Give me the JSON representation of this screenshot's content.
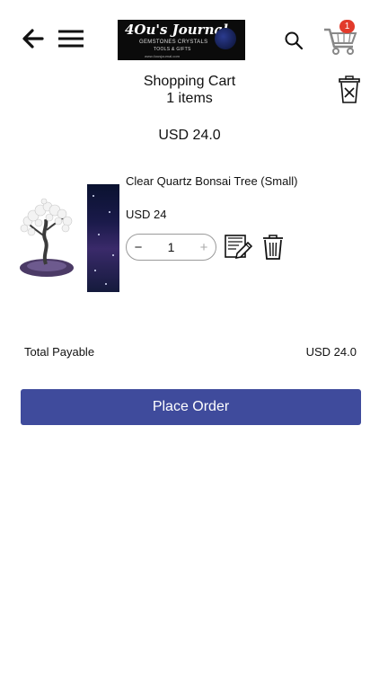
{
  "header": {
    "logo": {
      "line1": "4Ou's Journal",
      "line2": "GEMSTONES CRYSTALS",
      "line3": "TOOLS & GIFTS",
      "line4": "www.4ousjournal.com"
    },
    "cart_count": "1"
  },
  "cart": {
    "title": "Shopping Cart",
    "item_count": "1 items",
    "total": "USD 24.0"
  },
  "items": [
    {
      "name": "Clear Quartz Bonsai Tree (Small)",
      "price": "USD 24",
      "quantity": "1",
      "decrement_label": "−",
      "increment_label": "+"
    }
  ],
  "summary": {
    "total_label": "Total Payable",
    "total_value": "USD 24.0"
  },
  "actions": {
    "place_order_label": "Place Order"
  },
  "colors": {
    "primary": "#3f4b9c",
    "badge": "#e23a2b"
  },
  "icons": {
    "back": "back-arrow-icon",
    "menu": "menu-icon",
    "search": "search-icon",
    "cart": "cart-icon",
    "clear_cart": "clear-cart-icon",
    "edit": "edit-note-icon",
    "delete": "trash-icon"
  }
}
